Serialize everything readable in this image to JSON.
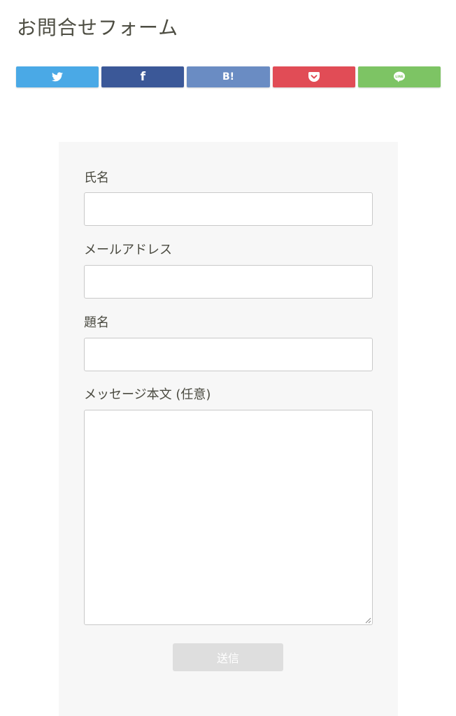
{
  "page": {
    "title": "お問合せフォーム"
  },
  "share": {
    "buttons": [
      {
        "name": "twitter",
        "icon": "twitter-bird-icon",
        "color": "#4aa9e6"
      },
      {
        "name": "facebook",
        "icon": "facebook-f-icon",
        "color": "#3b5898",
        "glyph": "f"
      },
      {
        "name": "hatena-bookmark",
        "icon": "hatena-bookmark-icon",
        "color": "#6a8cc3",
        "glyph": "B!"
      },
      {
        "name": "pocket",
        "icon": "pocket-icon",
        "color": "#e14c56"
      },
      {
        "name": "line",
        "icon": "line-icon",
        "color": "#7dc464",
        "glyph": "LINE"
      }
    ]
  },
  "form": {
    "name_label": "氏名",
    "name_value": "",
    "email_label": "メールアドレス",
    "email_value": "",
    "subject_label": "題名",
    "subject_value": "",
    "message_label": "メッセージ本文 (任意)",
    "message_value": "",
    "submit_label": "送信",
    "panel_color": "#f7f7f7",
    "submit_color": "#dedede"
  }
}
